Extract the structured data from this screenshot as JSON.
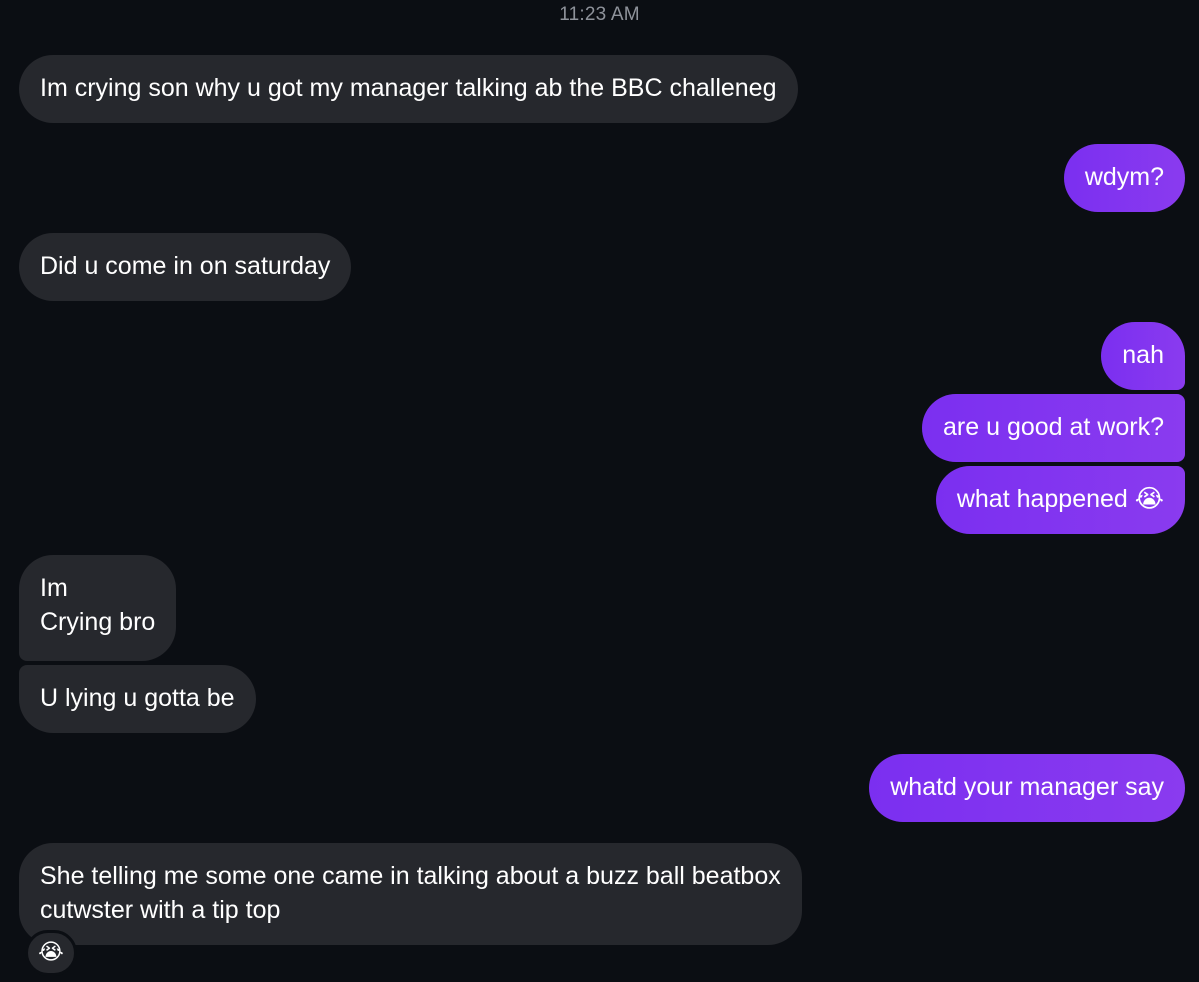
{
  "thread": {
    "timestamp": "11:23 AM"
  },
  "messages": [
    {
      "direction": "incoming",
      "text": "Im crying son why u got my manager talking ab the BBC challeneg"
    },
    {
      "direction": "outgoing",
      "text": "wdym?"
    },
    {
      "direction": "incoming",
      "text": "Did u come in on saturday"
    },
    {
      "direction": "outgoing",
      "text": "nah"
    },
    {
      "direction": "outgoing",
      "text": "are u good at work?"
    },
    {
      "direction": "outgoing",
      "text": "what happened 😭"
    },
    {
      "direction": "incoming",
      "text": "Im\nCrying bro"
    },
    {
      "direction": "incoming",
      "text": "U lying u gotta be"
    },
    {
      "direction": "outgoing",
      "text": "whatd your manager say"
    },
    {
      "direction": "incoming",
      "text": "She telling me some one came in talking about a buzz ball beatbox\ncutwster with a tip top"
    }
  ],
  "reaction": {
    "emoji": "😭",
    "on_message_index": 9
  },
  "colors": {
    "background": "#0b0e13",
    "incoming_bubble": "#26282d",
    "outgoing_bubble": "#7c3aed",
    "timestamp_text": "#8e929a"
  }
}
